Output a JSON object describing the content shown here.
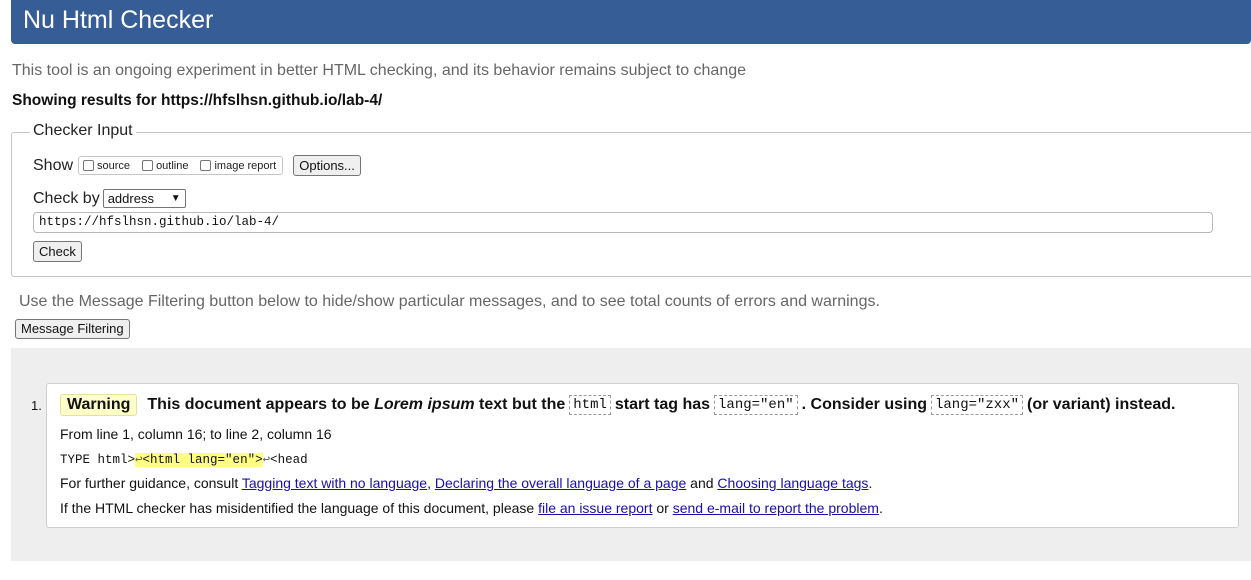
{
  "header": {
    "title": "Nu Html Checker"
  },
  "tagline": "This tool is an ongoing experiment in better HTML checking, and its behavior remains subject to change",
  "showing": {
    "prefix": "Showing results for ",
    "url": "https://hfslhsn.github.io/lab-4/"
  },
  "checker_input": {
    "legend": "Checker Input",
    "show_label": "Show",
    "show_options": [
      "source",
      "outline",
      "image report"
    ],
    "options_button": "Options...",
    "check_by_label": "Check by",
    "check_by_value": "address",
    "url_value": "https://hfslhsn.github.io/lab-4/",
    "check_button": "Check"
  },
  "filter": {
    "note": "Use the Message Filtering button below to hide/show particular messages, and to see total counts of errors and warnings.",
    "button": "Message Filtering"
  },
  "messages": [
    {
      "number": "1.",
      "type": "Warning",
      "text1": "This document appears to be ",
      "lorem": "Lorem ipsum",
      "text2": " text but the ",
      "code1": "html",
      "text3": " start tag has ",
      "code2": "lang=\"en\"",
      "text4": ". Consider using ",
      "code3": "lang=\"zxx\"",
      "text5": " (or variant) instead.",
      "location": "From line 1, column 16; to line 2, column 16",
      "extract_pre": "TYPE html>",
      "extract_lf1": "↩",
      "extract_hl": "<html lang=\"en\">",
      "extract_lf2": "↩",
      "extract_post": "<head",
      "guidance_prefix": "For further guidance, consult ",
      "link1": "Tagging text with no language",
      "sep1": ", ",
      "link2": "Declaring the overall language of a page",
      "sep2": " and ",
      "link3": "Choosing language tags",
      "guidance_suffix": ".",
      "misid_prefix": "If the HTML checker has misidentified the language of this document, please ",
      "link4": "file an issue report",
      "misid_mid": " or ",
      "link5": "send e-mail to report the problem",
      "misid_suffix": "."
    }
  ]
}
